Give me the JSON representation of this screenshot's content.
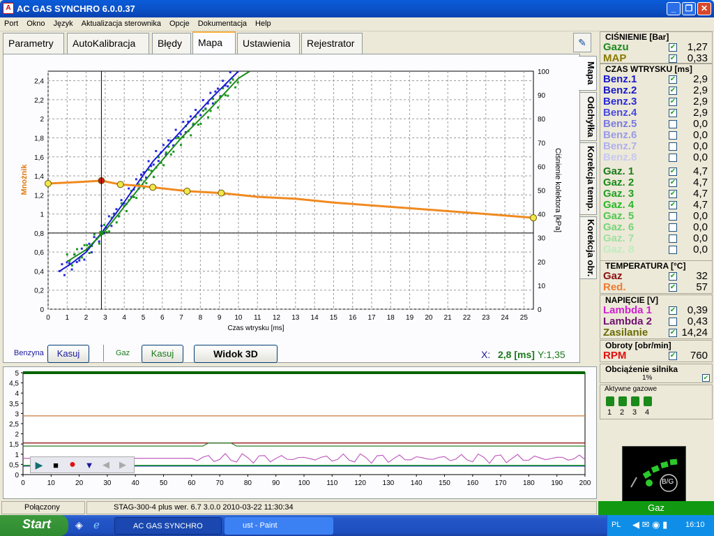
{
  "window": {
    "title": "AC GAS SYNCHRO  6.0.0.37"
  },
  "menu": [
    "Port",
    "Okno",
    "Język",
    "Aktualizacja sterownika",
    "Opcje",
    "Dokumentacja",
    "Help"
  ],
  "tabs": [
    "Parametry",
    "AutoKalibracja",
    "Błędy",
    "Mapa",
    "Ustawienia",
    "Rejestrator"
  ],
  "vtabs": [
    "Mapa",
    "Odchyłka",
    "Korekcja temp.",
    "Korekcja obr."
  ],
  "chart_data": [
    {
      "type": "scatter",
      "xlabel": "Czas wtrysku [ms]",
      "ylabel": "Mnożnik",
      "y2label": "Ciśnienie kolektora [kPa]",
      "xlim": [
        0,
        25.5
      ],
      "ylim": [
        0,
        2.5
      ],
      "y2lim": [
        0,
        100
      ],
      "xticks": [
        0,
        1,
        2,
        3,
        4,
        5,
        6,
        7,
        8,
        9,
        10,
        11,
        12,
        13,
        14,
        15,
        16,
        17,
        18,
        19,
        20,
        21,
        22,
        23,
        24,
        25
      ],
      "yticks": [
        "0",
        "0,2",
        "0,4",
        "0,6",
        "0,8",
        "1",
        "1,2",
        "1,4",
        "1,6",
        "1,8",
        "2",
        "2,2",
        "2,4"
      ],
      "y2ticks": [
        0,
        10,
        20,
        30,
        40,
        50,
        60,
        70,
        80,
        90,
        100
      ],
      "multiplier_curve": [
        [
          0,
          1.32
        ],
        [
          1,
          1.33
        ],
        [
          2,
          1.34
        ],
        [
          2.8,
          1.35
        ],
        [
          3.8,
          1.31
        ],
        [
          4.5,
          1.3
        ],
        [
          5.5,
          1.28
        ],
        [
          7.3,
          1.24
        ],
        [
          9.1,
          1.22
        ],
        [
          11,
          1.18
        ],
        [
          13,
          1.16
        ],
        [
          15,
          1.12
        ],
        [
          17,
          1.09
        ],
        [
          19,
          1.06
        ],
        [
          21,
          1.03
        ],
        [
          23,
          1.0
        ],
        [
          25.5,
          0.96
        ]
      ],
      "multiplier_points": [
        {
          "x": 0,
          "y": 1.32,
          "color": "#f2e64a"
        },
        {
          "x": 2.8,
          "y": 1.35,
          "color": "#d01818"
        },
        {
          "x": 3.8,
          "y": 1.31,
          "color": "#f2e64a"
        },
        {
          "x": 5.5,
          "y": 1.28,
          "color": "#f2e64a"
        },
        {
          "x": 7.3,
          "y": 1.24,
          "color": "#f2e64a"
        },
        {
          "x": 9.1,
          "y": 1.22,
          "color": "#f2e64a"
        },
        {
          "x": 25.5,
          "y": 0.96,
          "color": "#f2e64a"
        }
      ],
      "benzyna_line": [
        [
          0.6,
          16
        ],
        [
          1.2,
          19
        ],
        [
          2.0,
          24
        ],
        [
          2.8,
          32
        ],
        [
          4.0,
          45
        ],
        [
          5.5,
          62
        ],
        [
          7.0,
          75
        ],
        [
          8.5,
          88
        ],
        [
          10.0,
          100
        ]
      ],
      "gaz_line": [
        [
          1.0,
          20
        ],
        [
          2.0,
          25
        ],
        [
          3.0,
          33
        ],
        [
          4.0,
          43
        ],
        [
          5.5,
          58
        ],
        [
          7.0,
          72
        ],
        [
          8.5,
          84
        ],
        [
          10.0,
          97
        ],
        [
          10.6,
          100
        ]
      ],
      "cursor": {
        "x": 2.8,
        "y": 0.8
      },
      "readout": {
        "x_label": "X:",
        "x_value": "2,8 [ms]",
        "y_label": "Y:1,35"
      }
    },
    {
      "type": "line",
      "xlim": [
        0,
        200
      ],
      "ylim": [
        0,
        5
      ],
      "xticks": [
        0,
        10,
        20,
        30,
        40,
        50,
        60,
        70,
        80,
        90,
        100,
        110,
        120,
        130,
        140,
        150,
        160,
        170,
        180,
        190,
        200
      ],
      "yticks": [
        "0",
        "0,5",
        "1",
        "1,5",
        "2",
        "2,5",
        "3",
        "3,5",
        "4",
        "4,5",
        "5"
      ],
      "series": [
        {
          "color": "#c87a3a",
          "level": 2.88
        },
        {
          "color": "#8b0000",
          "level": 1.55
        },
        {
          "color": "#2a7d2a",
          "level": 1.4
        },
        {
          "color": "#c060c0",
          "level": 0.8
        },
        {
          "color": "#1a1ab0",
          "level": 0.42
        },
        {
          "color": "#00a000",
          "level": 0.45
        },
        {
          "color": "#006400",
          "level": 5.0
        }
      ]
    }
  ],
  "bottom": {
    "benzyna": "Benzyna",
    "kasuj1": "Kasuj",
    "gaz": "Gaz",
    "kasuj2": "Kasuj",
    "widok": "Widok 3D"
  },
  "status": {
    "conn": "Połączony",
    "device": "STAG-300-4 plus   wer. 6.7  3.0.0     2010-03-22 11:30:34",
    "mode": "Gaz"
  },
  "side": {
    "cisnienie": {
      "title": "CIŚNIENIE [Bar]",
      "rows": [
        {
          "n": "Gazu",
          "v": "1,27",
          "c": "#1f8a1f",
          "chk": true
        },
        {
          "n": "MAP",
          "v": "0,33",
          "c": "#8a7a00",
          "chk": true
        }
      ]
    },
    "czas": {
      "title": "CZAS WTRYSKU  [ms]",
      "rows": [
        {
          "n": "Benz.1",
          "v": "2,9",
          "c": "#1a1ac8",
          "chk": true
        },
        {
          "n": "Benz.2",
          "v": "2,9",
          "c": "#1a1ac8",
          "chk": true
        },
        {
          "n": "Benz.3",
          "v": "2,9",
          "c": "#2a2ad8",
          "chk": true
        },
        {
          "n": "Benz.4",
          "v": "2,9",
          "c": "#4a4ae0",
          "chk": true
        },
        {
          "n": "Benz.5",
          "v": "0,0",
          "c": "#7a7ae0",
          "chk": false
        },
        {
          "n": "Benz.6",
          "v": "0,0",
          "c": "#9a9ae8",
          "chk": false
        },
        {
          "n": "Benz.7",
          "v": "0,0",
          "c": "#b0b0ee",
          "chk": false
        },
        {
          "n": "Benz.8",
          "v": "0,0",
          "c": "#c8c8f4",
          "chk": false
        },
        {
          "n": "Gaz. 1",
          "v": "4,7",
          "c": "#1a7a1a",
          "chk": true
        },
        {
          "n": "Gaz. 2",
          "v": "4,7",
          "c": "#1a8a1a",
          "chk": true
        },
        {
          "n": "Gaz. 3",
          "v": "4,7",
          "c": "#22a022",
          "chk": true
        },
        {
          "n": "Gaz. 4",
          "v": "4,7",
          "c": "#2ab82a",
          "chk": true
        },
        {
          "n": "Gaz. 5",
          "v": "0,0",
          "c": "#50c850",
          "chk": false
        },
        {
          "n": "Gaz. 6",
          "v": "0,0",
          "c": "#78d478",
          "chk": false
        },
        {
          "n": "Gaz. 7",
          "v": "0,0",
          "c": "#a0e0a0",
          "chk": false
        },
        {
          "n": "Gaz. 8",
          "v": "0,0",
          "c": "#c0ecc0",
          "chk": false
        }
      ]
    },
    "temp": {
      "title": "TEMPERATURA  [°C]",
      "rows": [
        {
          "n": "Gaz",
          "v": "32",
          "c": "#8b1010",
          "chk": true
        },
        {
          "n": "Red.",
          "v": "57",
          "c": "#f07a30",
          "chk": true
        }
      ]
    },
    "napiecie": {
      "title": "NAPIĘCIE [V]",
      "rows": [
        {
          "n": "Lambda 1",
          "v": "0,39",
          "c": "#d020d0",
          "chk": true
        },
        {
          "n": "Lambda 2",
          "v": "0,43",
          "c": "#701070",
          "chk": false
        },
        {
          "n": "Zasilanie",
          "v": "14,24",
          "c": "#6a6a00",
          "chk": true
        }
      ]
    },
    "obroty": {
      "title": "Obroty [obr/min]",
      "rows": [
        {
          "n": "RPM",
          "v": "760",
          "c": "#e01010",
          "chk": true
        }
      ]
    },
    "obciazenie": {
      "title": "Obciążenie silnika",
      "value": "1%"
    },
    "aktywne": {
      "title": "Aktywne gazowe",
      "nums": [
        "1",
        "2",
        "3",
        "4"
      ]
    },
    "bg": "B/G"
  },
  "taskbar": {
    "start": "Start",
    "items": [
      "AC GAS SYNCHRO",
      "ust - Paint"
    ],
    "lang": "PL",
    "clock": "16:10"
  }
}
